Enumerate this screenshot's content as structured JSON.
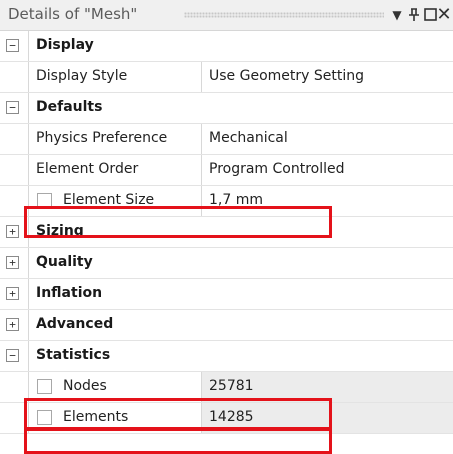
{
  "panel": {
    "title": "Details of \"Mesh\"",
    "controls": {
      "dropdown_icon": "triangle-down-icon",
      "pin_icon": "pin-icon",
      "maximize_icon": "maximize-icon",
      "close_icon": "close-icon"
    }
  },
  "tree": {
    "display": {
      "label": "Display",
      "expanded": true,
      "props": [
        {
          "name": "Display Style",
          "value": "Use Geometry Setting"
        }
      ]
    },
    "defaults": {
      "label": "Defaults",
      "expanded": true,
      "props": [
        {
          "name": "Physics Preference",
          "value": "Mechanical"
        },
        {
          "name": "Element Order",
          "value": "Program Controlled"
        },
        {
          "name": "Element Size",
          "value": "1,7 mm"
        }
      ]
    },
    "sizing": {
      "label": "Sizing",
      "expanded": false
    },
    "quality": {
      "label": "Quality",
      "expanded": false
    },
    "inflation": {
      "label": "Inflation",
      "expanded": false
    },
    "advanced": {
      "label": "Advanced",
      "expanded": false
    },
    "statistics": {
      "label": "Statistics",
      "expanded": true,
      "props": [
        {
          "name": "Nodes",
          "value": "25781"
        },
        {
          "name": "Elements",
          "value": "14285"
        }
      ]
    }
  },
  "symbols": {
    "minus": "−",
    "plus": "+",
    "close": "✕",
    "dropdown": "▼"
  },
  "colors": {
    "highlight": "#e4121a",
    "readonly_bg": "#ececec"
  }
}
